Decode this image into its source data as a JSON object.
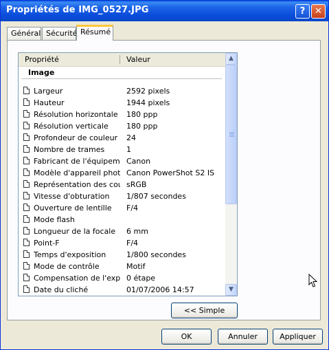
{
  "window": {
    "title": "Propriétés de IMG_0527.JPG",
    "help_glyph": "?",
    "close_glyph": "✕"
  },
  "tabs": [
    {
      "label": "Général"
    },
    {
      "label": "Sécurité"
    },
    {
      "label": "Résumé",
      "active": true
    }
  ],
  "list": {
    "col_property": "Propriété",
    "col_value": "Valeur",
    "group": "Image",
    "rows": [
      {
        "name": "Largeur",
        "value": "2592 pixels"
      },
      {
        "name": "Hauteur",
        "value": "1944 pixels"
      },
      {
        "name": "Résolution horizontale",
        "value": "180 ppp"
      },
      {
        "name": "Résolution verticale",
        "value": "180 ppp"
      },
      {
        "name": "Profondeur de couleur",
        "value": "24"
      },
      {
        "name": "Nombre de trames",
        "value": "1"
      },
      {
        "name": "Fabricant de l'équipement",
        "value": "Canon"
      },
      {
        "name": "Modèle d'appareil photo",
        "value": "Canon PowerShot S2 IS"
      },
      {
        "name": "Représentation des cou...",
        "value": "sRGB"
      },
      {
        "name": "Vitesse d'obturation",
        "value": "1/807 secondes"
      },
      {
        "name": "Ouverture de lentille",
        "value": "F/4"
      },
      {
        "name": "Mode flash",
        "value": ""
      },
      {
        "name": "Longueur de la focale",
        "value": "6 mm"
      },
      {
        "name": "Point-F",
        "value": "F/4"
      },
      {
        "name": "Temps d'exposition",
        "value": "1/800 secondes"
      },
      {
        "name": "Mode de contrôle",
        "value": "Motif"
      },
      {
        "name": "Compensation de l'expo...",
        "value": "0 étape"
      },
      {
        "name": "Date du cliché",
        "value": "01/07/2006 14:57"
      }
    ]
  },
  "buttons": {
    "simple": "<< Simple",
    "ok": "OK",
    "cancel": "Annuler",
    "apply": "Appliquer"
  }
}
